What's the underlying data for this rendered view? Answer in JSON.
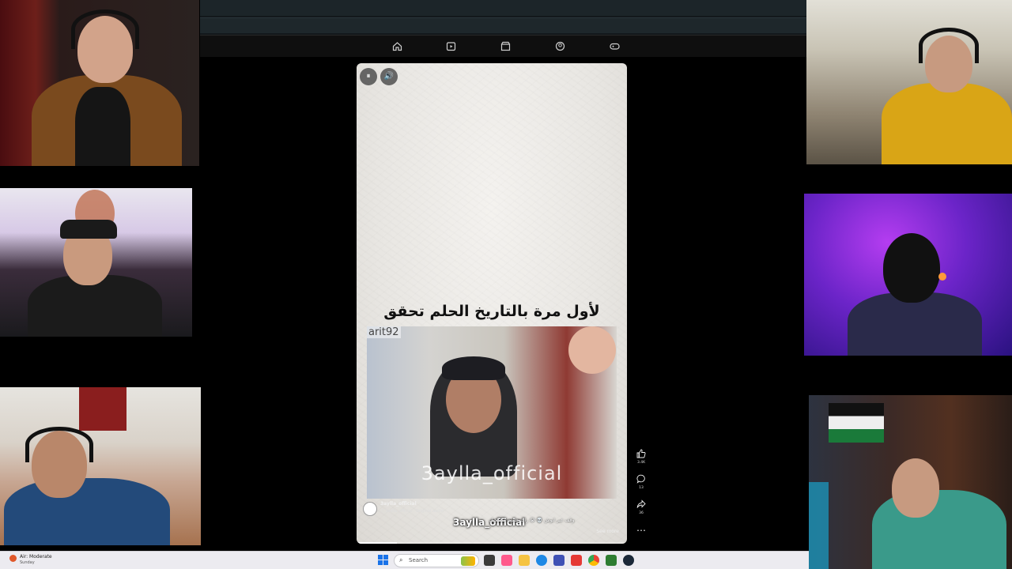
{
  "nav": {
    "icons": [
      "home-icon",
      "shorts-icon",
      "store-icon",
      "account-icon",
      "gaming-icon"
    ]
  },
  "video": {
    "overlay_text": "لأول مرة بالتاريخ الحلم تحقق",
    "clip_tag": "arit92",
    "clip_watermark": "3aylla_official",
    "channel_name": "3aylla_official",
    "audio_line": "♫ 3aylla_official · Original audio",
    "caption_watermark": "3aylla_official",
    "description": "وقف عير ابوش 💀 😭 راك حلمت مستحيل",
    "see_more": "See more",
    "progress": 0.15,
    "pause_glyph": "⏸",
    "volume_glyph": "🔊"
  },
  "actions": {
    "like_count": "3.4K",
    "comment_count": "13",
    "share_count": "36",
    "more_glyph": "⋯"
  },
  "taskbar": {
    "weather_title": "Air: Moderate",
    "weather_sub": "Sunday",
    "search_label": "Search",
    "search_glyph": "⌕"
  },
  "colors": {
    "accent_blue": "#1a73e8",
    "weather_orange": "#e0582a"
  }
}
